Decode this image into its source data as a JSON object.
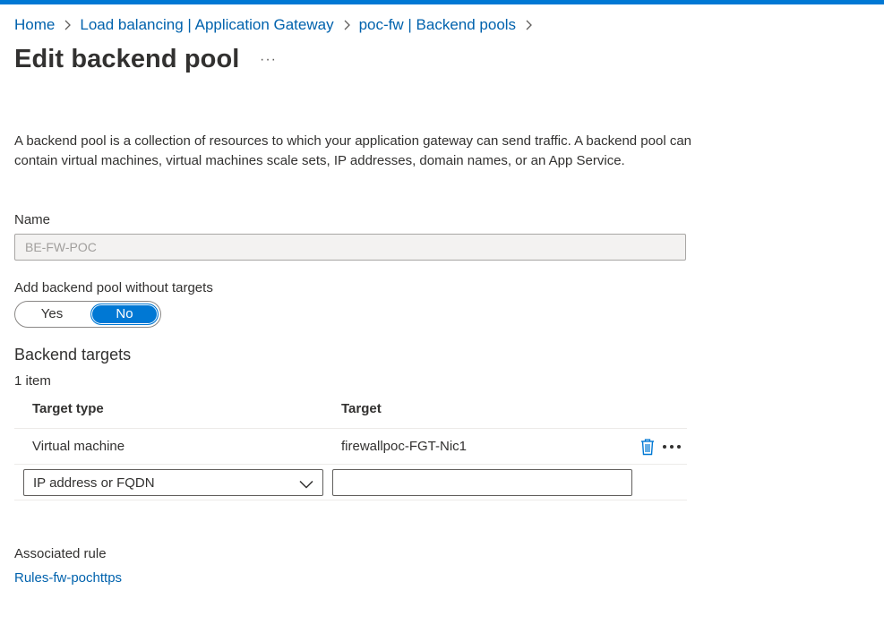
{
  "breadcrumb": {
    "items": [
      "Home",
      "Load balancing | Application Gateway",
      "poc-fw | Backend pools"
    ]
  },
  "page": {
    "title": "Edit backend pool",
    "more_label": "···"
  },
  "description": "A backend pool is a collection of resources to which your application gateway can send traffic. A backend pool can contain virtual machines, virtual machines scale sets, IP addresses, domain names, or an App Service.",
  "name_field": {
    "label": "Name",
    "value": "BE-FW-POC"
  },
  "without_targets": {
    "label": "Add backend pool without targets",
    "yes": "Yes",
    "no": "No",
    "selected": "No"
  },
  "backend_targets": {
    "title": "Backend targets",
    "count": "1 item",
    "columns": [
      "Target type",
      "Target"
    ],
    "rows": [
      {
        "type": "Virtual machine",
        "target": "firewallpoc-FGT-Nic1"
      }
    ],
    "new_row": {
      "type_selected": "IP address or FQDN",
      "target_value": ""
    }
  },
  "associated_rule": {
    "label": "Associated rule",
    "link": "Rules-fw-pochttps"
  },
  "icons": {
    "separator": "chevron-right-icon",
    "delete": "trash-icon",
    "row_more": "more-horizontal-icon",
    "dropdown": "chevron-down-icon"
  },
  "colors": {
    "accent": "#0078d4",
    "link": "#0062ad",
    "text": "#323130"
  }
}
